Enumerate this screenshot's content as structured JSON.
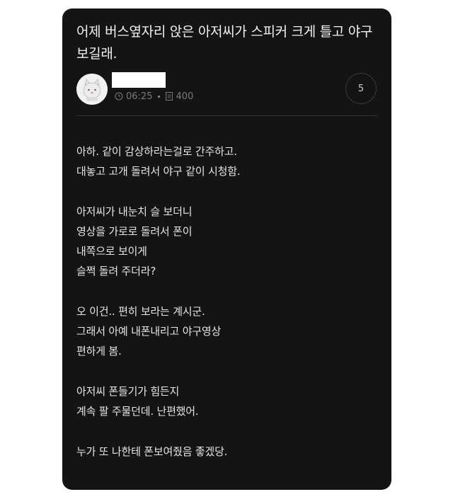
{
  "post": {
    "title": "어제 버스옆자리 앉은 아저씨가 스피커 크게 틀고 야구 보길래.",
    "author_name": "",
    "time": "06:25",
    "views": "400",
    "comment_count": "5"
  },
  "icons": {
    "clock": "clock-icon",
    "views": "document-icon",
    "avatar": "cat-avatar"
  },
  "body": {
    "paragraphs": [
      {
        "lines": [
          "아하. 같이 감상하라는걸로 간주하고.",
          "대놓고 고개 돌려서 야구 같이 시청함."
        ]
      },
      {
        "lines": [
          "아저씨가 내눈치 슬 보더니",
          "영상을 가로로 돌려서 폰이",
          "내쪽으로 보이게",
          "슬쩍 돌려 주더라?"
        ]
      },
      {
        "lines": [
          "오 이건.. 편히 보라는 계시군.",
          "그래서 아예 내폰내리고 야구영상",
          "편하게 봄."
        ]
      },
      {
        "lines": [
          "아저씨 폰들기가 힘든지",
          "계속 팔 주물던데. 난편했어."
        ]
      },
      {
        "lines": [
          "누가 또 나한테 폰보여줬음 좋겠당."
        ]
      }
    ]
  },
  "colors": {
    "card_bg": "#141414",
    "text": "#e6e6e6",
    "meta": "#7a7a7a"
  }
}
